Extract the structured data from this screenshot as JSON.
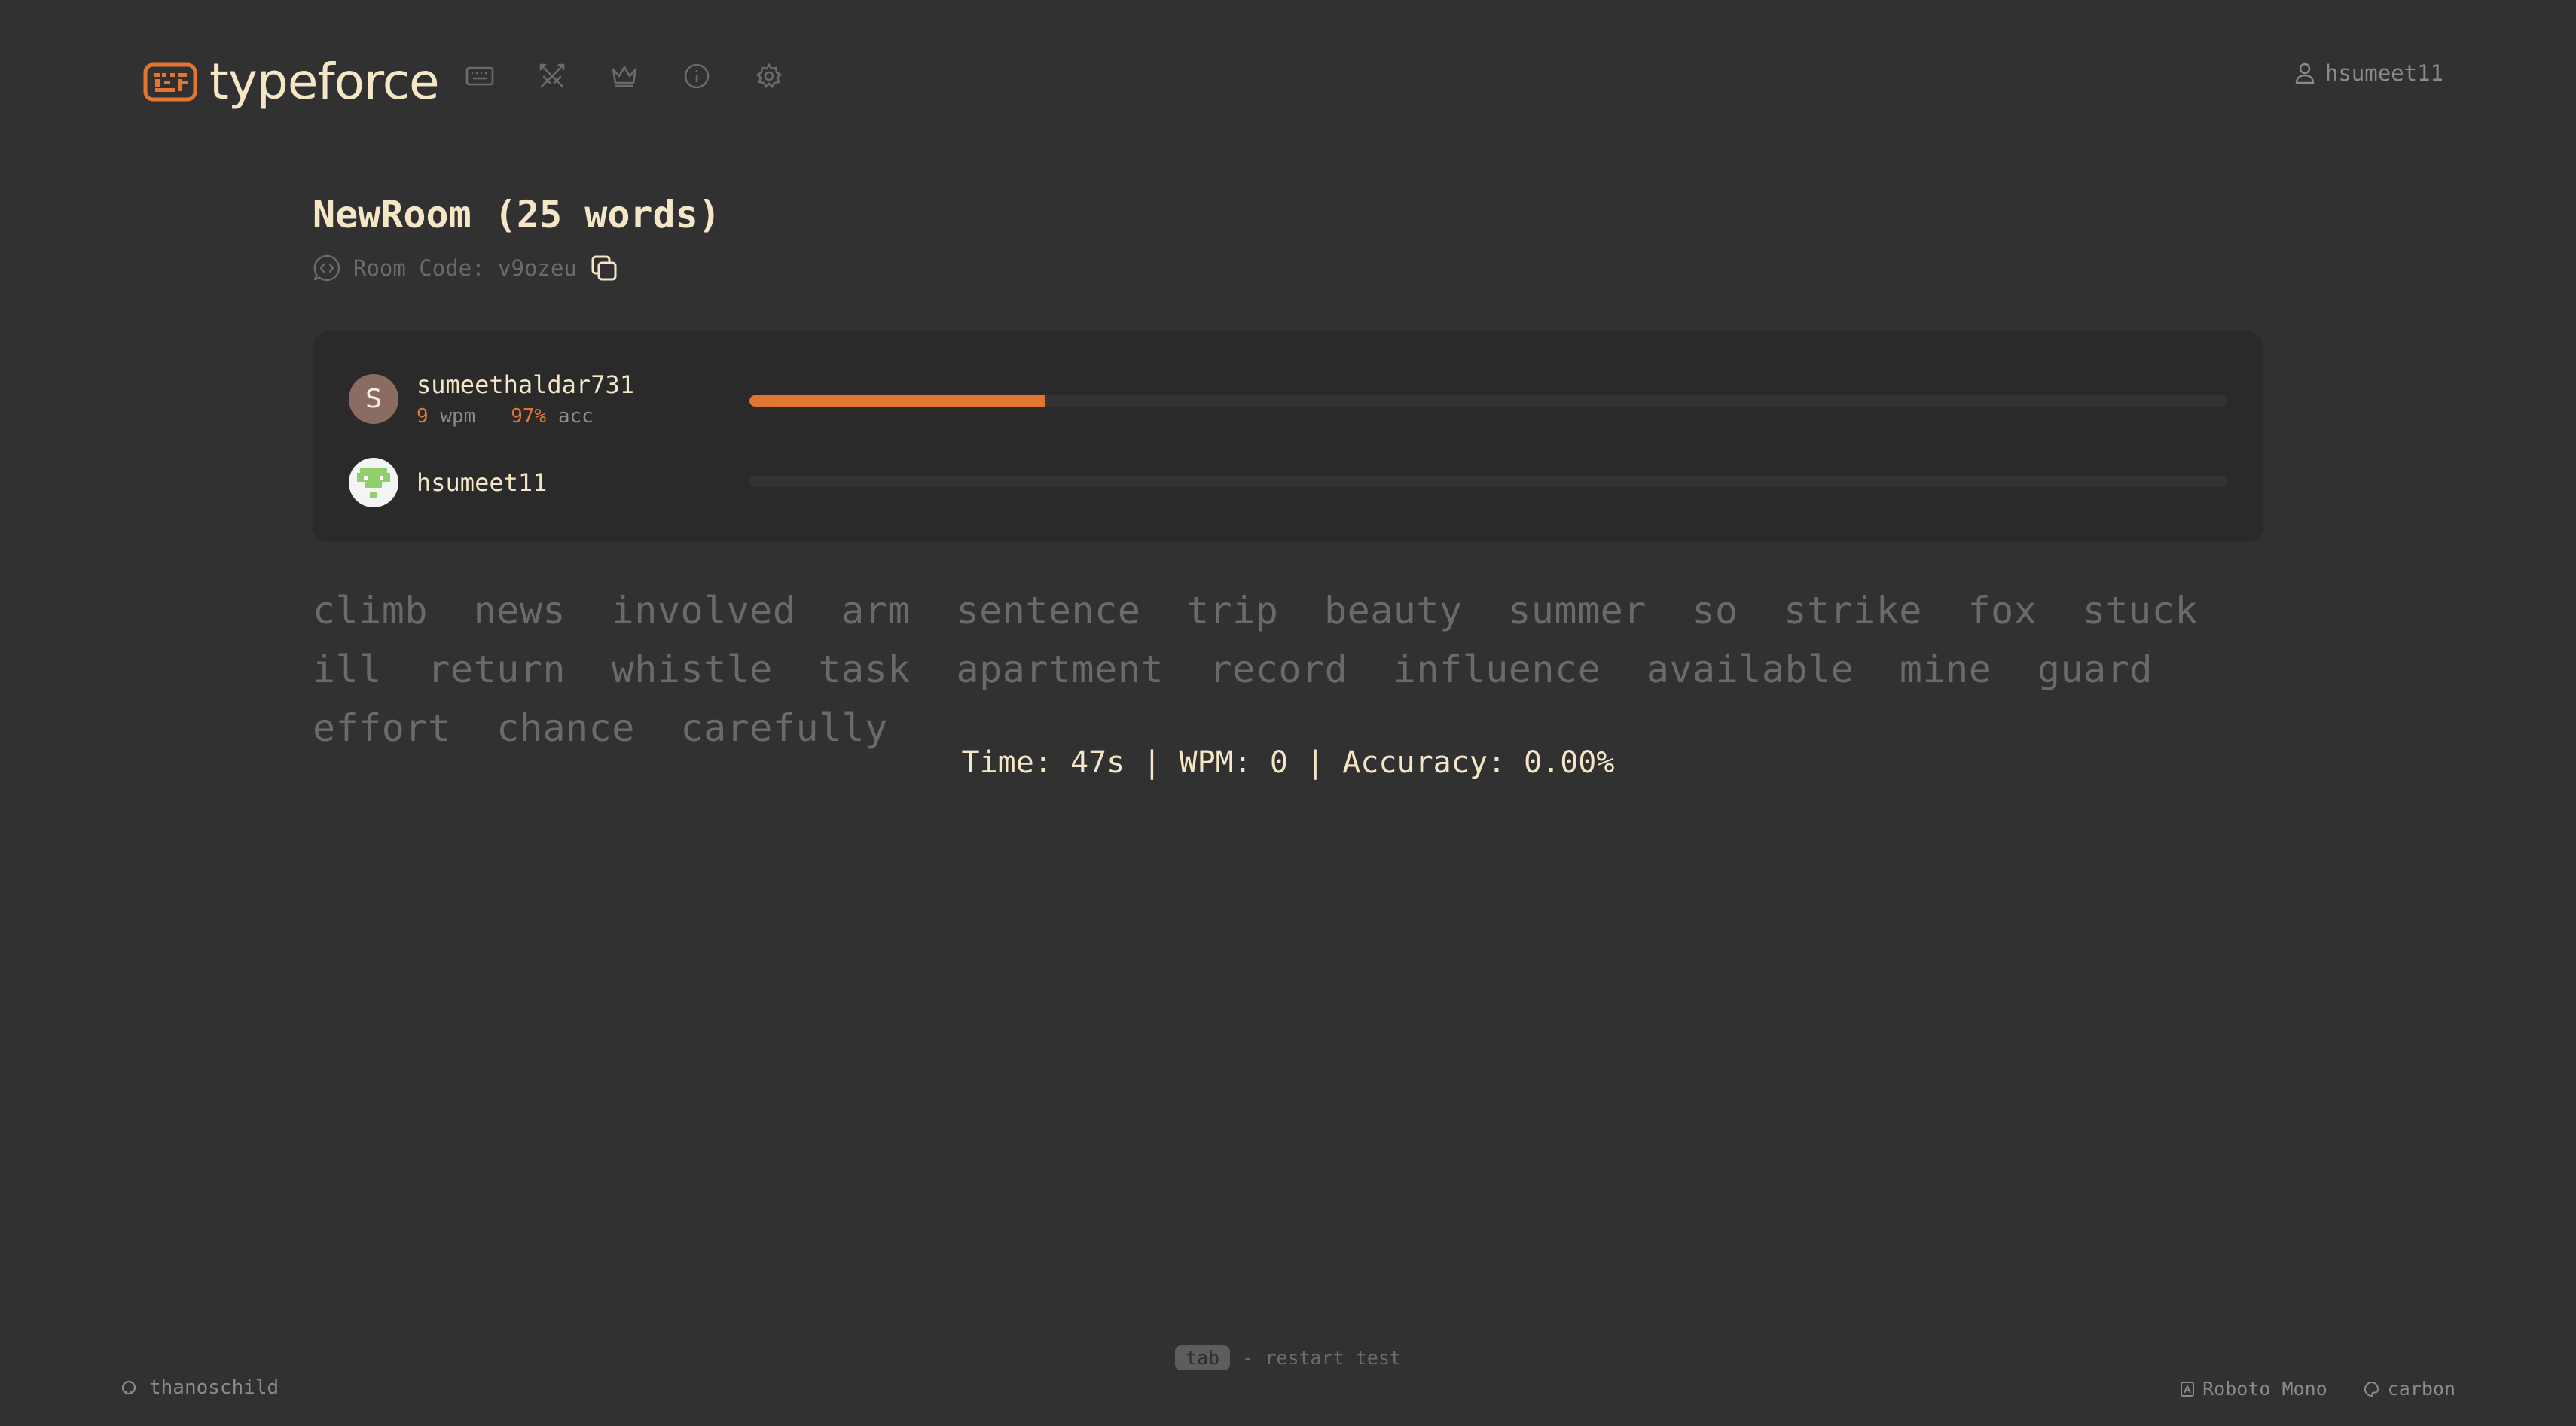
{
  "app": {
    "title": "typeforce",
    "accent": "#e37533",
    "background": "#313131",
    "text": "#f5e6c8"
  },
  "nav": [
    {
      "icon": "keyboard-icon"
    },
    {
      "icon": "crossed-swords-icon"
    },
    {
      "icon": "crown-icon"
    },
    {
      "icon": "info-icon"
    },
    {
      "icon": "gear-icon"
    }
  ],
  "user": {
    "name": "hsumeet11",
    "icon": "user-icon"
  },
  "room": {
    "title": "NewRoom (25 words)",
    "code_label": "Room Code: v9ozeu"
  },
  "players": [
    {
      "name": "sumeethaldar731",
      "avatar_letter": "S",
      "wpm": "9",
      "wpm_label": "wpm",
      "acc": "97%",
      "acc_label": "acc",
      "progress": 0.2
    },
    {
      "name": "hsumeet11",
      "progress": 0
    }
  ],
  "words": [
    "climb",
    "news",
    "involved",
    "arm",
    "sentence",
    "trip",
    "beauty",
    "summer",
    "so",
    "strike",
    "fox",
    "stuck",
    "ill",
    "return",
    "whistle",
    "task",
    "apartment",
    "record",
    "influence",
    "available",
    "mine",
    "guard",
    "effort",
    "chance",
    "carefully"
  ],
  "results": {
    "text": "Time: 47s | WPM: 0 | Accuracy: 0.00%"
  },
  "footer": {
    "hint_key": "tab",
    "hint_text": "- restart test",
    "github": "thanoschild",
    "font": "Roboto Mono",
    "theme": "carbon"
  }
}
